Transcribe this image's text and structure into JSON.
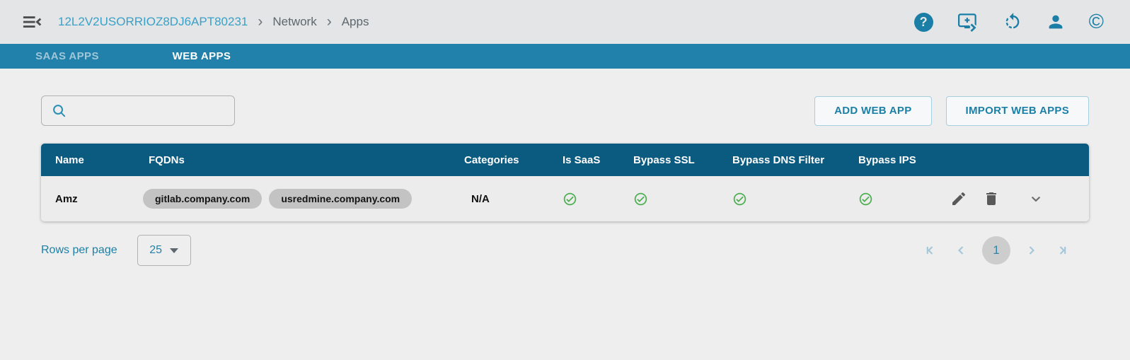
{
  "header": {
    "breadcrumb": {
      "root": "12L2V2USORRIOZ8DJ6APT80231",
      "items": [
        "Network",
        "Apps"
      ],
      "separator": "›"
    }
  },
  "icons": {
    "help_glyph": "?",
    "copyright_glyph": "©"
  },
  "tabs": {
    "saas": "SAAS APPS",
    "web": "WEB APPS"
  },
  "toolbar": {
    "search_placeholder": "",
    "search_value": "",
    "add_web_app": "ADD WEB APP",
    "import_web_apps": "IMPORT WEB APPS"
  },
  "table": {
    "columns": [
      "Name",
      "FQDNs",
      "Categories",
      "Is SaaS",
      "Bypass SSL",
      "Bypass DNS Filter",
      "Bypass IPS"
    ],
    "rows": [
      {
        "name": "Amz",
        "fqdns": [
          "gitlab.company.com",
          "usredmine.company.com"
        ],
        "categories": "N/A",
        "is_saas": "yes",
        "bypass_ssl": "yes",
        "bypass_dns_filter": "yes",
        "bypass_ips": "yes"
      }
    ]
  },
  "pagination": {
    "rows_per_page_label": "Rows per page",
    "rows_per_page_value": "25",
    "current_page": "1"
  },
  "colors": {
    "accent_teal": "#1b80a8",
    "tab_bar": "#2181ab",
    "table_header": "#0b5a80",
    "breadcrumb_link": "#3aa0c8",
    "success_green": "#4caf50",
    "chip_gray": "#c3c3c3"
  }
}
